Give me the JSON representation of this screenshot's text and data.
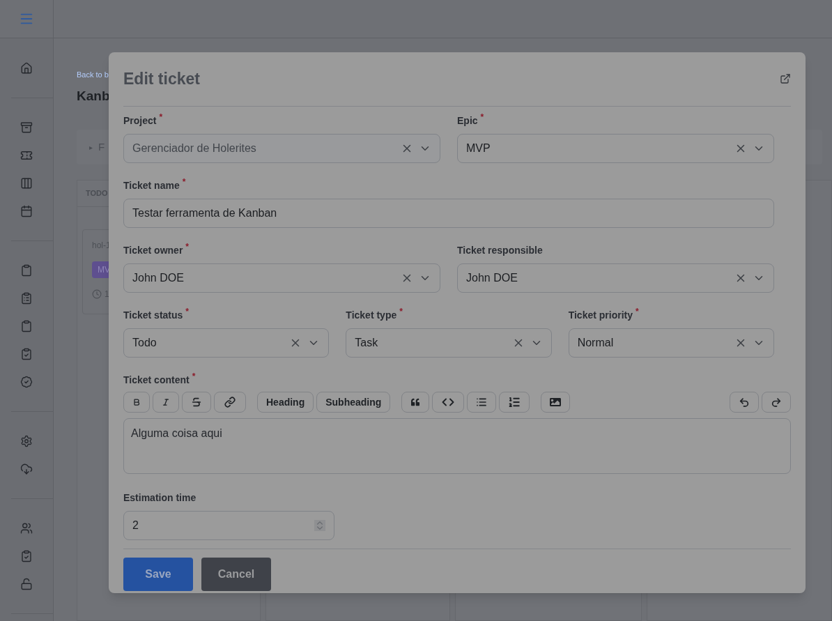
{
  "background": {
    "back_link": "Back to b",
    "title": "Kanb",
    "filter_toggle": "▸",
    "filter_label": "F",
    "column_title": "TODO",
    "card": {
      "id": "hol-1",
      "tag": "MV",
      "estimate": "1"
    }
  },
  "modal": {
    "title": "Edit ticket",
    "rows": [
      [
        {
          "kind": "select",
          "label": "Project",
          "marker": "*",
          "value": "Gerenciador de Holerites",
          "disabled": true
        },
        {
          "kind": "select",
          "label": "Epic",
          "marker": "*",
          "value": "MVP",
          "disabled": false
        }
      ],
      [
        {
          "kind": "text",
          "label": "Ticket name",
          "marker": "*",
          "value": "Testar ferramenta de Kanban",
          "disabled": false
        }
      ],
      [
        {
          "kind": "select",
          "label": "Ticket owner",
          "marker": "*",
          "value": "John DOE",
          "disabled": false
        },
        {
          "kind": "select",
          "label": "Ticket responsible",
          "value": "John DOE",
          "disabled": false
        }
      ],
      [
        {
          "kind": "select",
          "label": "Ticket status",
          "marker": "*",
          "value": "Todo",
          "disabled": false
        },
        {
          "kind": "select",
          "label": "Ticket type",
          "marker": "*",
          "value": "Task",
          "disabled": false
        },
        {
          "kind": "select",
          "label": "Ticket priority",
          "marker": "*",
          "value": "Normal",
          "disabled": false
        }
      ]
    ],
    "content": {
      "label": "Ticket content",
      "marker": "*",
      "heading_button": "Heading",
      "subheading_button": "Subheading",
      "value": "Alguma coisa aqui"
    },
    "estimation": {
      "label": "Estimation time",
      "value": "2"
    },
    "buttons": [
      {
        "label": "Save",
        "kind": "primary"
      },
      {
        "label": "Cancel",
        "kind": "secondary"
      }
    ]
  }
}
